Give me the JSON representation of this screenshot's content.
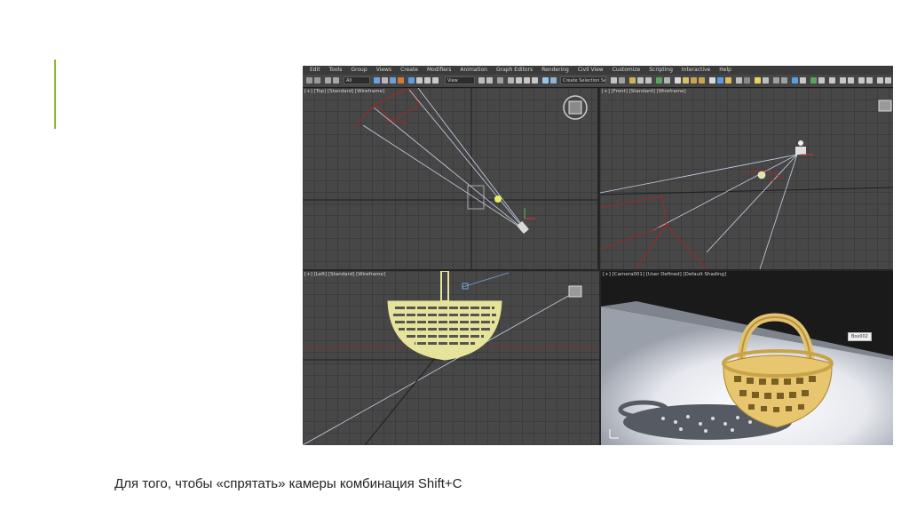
{
  "menubar": {
    "items": [
      "Edit",
      "Tools",
      "Group",
      "Views",
      "Create",
      "Modifiers",
      "Animation",
      "Graph Editors",
      "Rendering",
      "Civil View",
      "Customize",
      "Scripting",
      "Interactive",
      "Help"
    ]
  },
  "toolbar": {
    "selection_filter": "All",
    "reference_coord": "View",
    "named_selection": "Create Selection Se"
  },
  "viewports": {
    "top_left": {
      "label": "[+] [Top] [Standard] [Wireframe]"
    },
    "top_right": {
      "label": "[+] [Front] [Standard] [Wireframe]"
    },
    "bottom_left": {
      "label": "[+] [Left] [Standard] [Wireframe]"
    },
    "bottom_right": {
      "label": "[+] [Camera001] [User Defined] [Default Shading]",
      "object_tag": "Box002"
    }
  },
  "colors": {
    "accent": "#8db832",
    "basket": "#e6e39a",
    "camera_line": "#c9d3e8",
    "frustum_red": "#b52020"
  },
  "caption": "Для того, чтобы «спрятать» камеры комбинация Shift+C"
}
